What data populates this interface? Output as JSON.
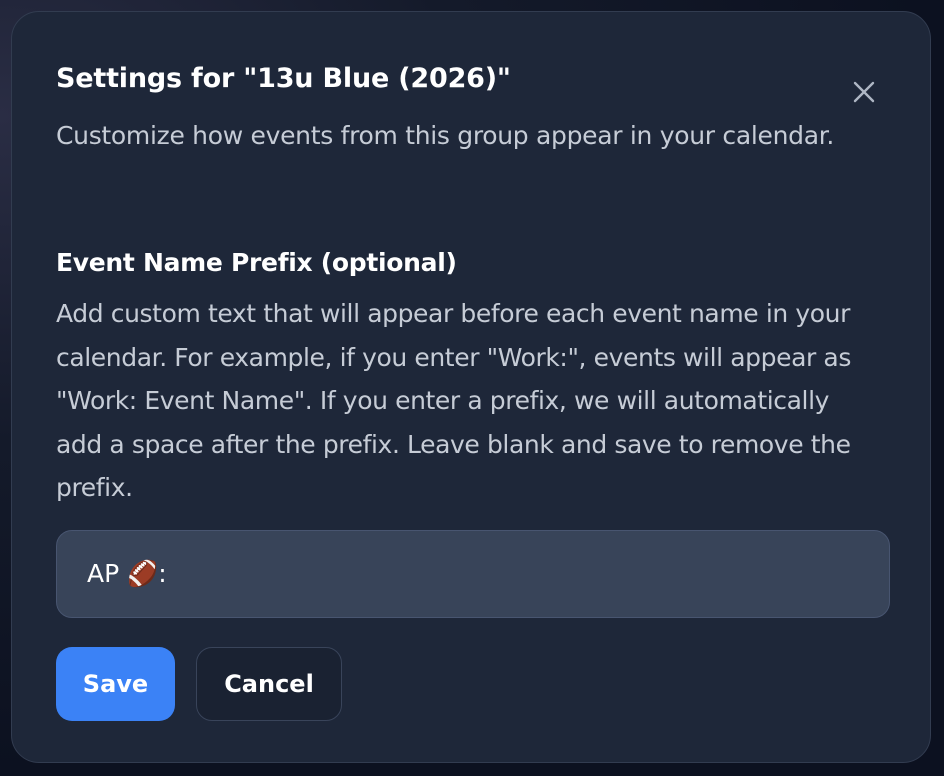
{
  "dialog": {
    "title": "Settings for \"13u Blue (2026)\"",
    "subtitle": "Customize how events from this group appear in your calendar.",
    "close_icon": "close-icon"
  },
  "prefix_section": {
    "heading": "Event Name Prefix (optional)",
    "description": "Add custom text that will appear before each event name in your calendar. For example, if you enter \"Work:\", events will appear as \"Work: Event Name\". If you enter a prefix, we will automatically add a space after the prefix. Leave blank and save to remove the prefix.",
    "input_value": "AP 🏈:"
  },
  "actions": {
    "save_label": "Save",
    "cancel_label": "Cancel"
  },
  "colors": {
    "dialog_bg": "#1e2739",
    "primary": "#3b82f6",
    "input_bg": "#384459"
  }
}
